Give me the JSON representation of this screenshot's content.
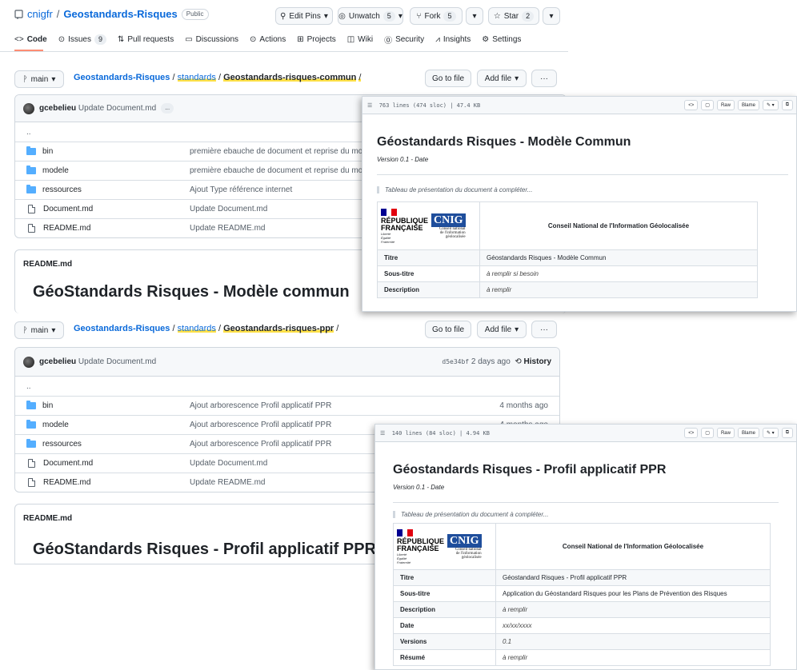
{
  "repo": {
    "owner": "cnigfr",
    "separator": "/",
    "name": "Geostandards-Risques",
    "visibility": "Public",
    "edit_pins": "Edit Pins",
    "unwatch": "Unwatch",
    "unwatch_count": "5",
    "fork": "Fork",
    "fork_count": "5",
    "star": "Star",
    "star_count": "2"
  },
  "tabs": [
    {
      "label": "Code"
    },
    {
      "label": "Issues",
      "count": "9"
    },
    {
      "label": "Pull requests"
    },
    {
      "label": "Discussions"
    },
    {
      "label": "Actions"
    },
    {
      "label": "Projects"
    },
    {
      "label": "Wiki"
    },
    {
      "label": "Security"
    },
    {
      "label": "Insights"
    },
    {
      "label": "Settings"
    }
  ],
  "common": {
    "branch": "main",
    "crumb_root": "Geostandards-Risques",
    "crumb_mid": "standards",
    "crumb_leaf": "Geostandards-risques-commun",
    "go_to_file": "Go to file",
    "add_file": "Add file",
    "more": "···",
    "commit_author": "gcebelieu",
    "commit_message": "Update Document.md",
    "commit_more": "...",
    "parent": "..",
    "files": [
      {
        "name": "bin",
        "message": "première ebauche de document et reprise du mo"
      },
      {
        "name": "modele",
        "message": "première ebauche de document et reprise du mo"
      },
      {
        "name": "ressources",
        "message": "Ajout Type référence internet"
      },
      {
        "name": "Document.md",
        "message": "Update Document.md"
      },
      {
        "name": "README.md",
        "message": "Update README.md"
      }
    ],
    "readme_label": "README.md",
    "readme_title": "GéoStandards Risques - Modèle commun"
  },
  "ppr": {
    "branch": "main",
    "crumb_root": "Geostandards-Risques",
    "crumb_mid": "standards",
    "crumb_leaf": "Geostandards-risques-ppr",
    "go_to_file": "Go to file",
    "add_file": "Add file",
    "more": "···",
    "commit_author": "gcebelieu",
    "commit_message": "Update Document.md",
    "commit_hash": "d5e34bf",
    "commit_time": "2 days ago",
    "history": "History",
    "parent": "..",
    "files": [
      {
        "name": "bin",
        "message": "Ajout arborescence Profil applicatif PPR",
        "time": "4 months ago"
      },
      {
        "name": "modele",
        "message": "Ajout arborescence Profil applicatif PPR",
        "time": "4 months ago"
      },
      {
        "name": "ressources",
        "message": "Ajout arborescence Profil applicatif PPR",
        "time": ""
      },
      {
        "name": "Document.md",
        "message": "Update Document.md",
        "time": ""
      },
      {
        "name": "README.md",
        "message": "Update README.md",
        "time": ""
      }
    ],
    "readme_label": "README.md",
    "readme_title": "GéoStandards Risques - Profil applicatif PPR"
  },
  "doc1": {
    "lines": "763 lines (474 sloc)",
    "size": "47.4 KB",
    "raw": "Raw",
    "blame": "Blame",
    "title": "Géostandards Risques - Modèle Commun",
    "version": "Version 0.1 - Date",
    "note": "Tableau de présentation du document à compléter...",
    "org": "Conseil National de l'Information Géolocalisée",
    "rows": [
      {
        "k": "Titre",
        "v": "Géostandards Risques - Modèle Commun",
        "italic": false
      },
      {
        "k": "Sous-titre",
        "v": "à remplir si besoin",
        "italic": true
      },
      {
        "k": "Description",
        "v": "à remplir",
        "italic": true
      }
    ]
  },
  "doc2": {
    "lines": "140 lines (84 sloc)",
    "size": "4.94 KB",
    "raw": "Raw",
    "blame": "Blame",
    "title": "Géostandards Risques - Profil applicatif PPR",
    "version": "Version 0.1 - Date",
    "note": "Tableau de présentation du document à compléter...",
    "org": "Conseil National de l'Information Géolocalisée",
    "rows": [
      {
        "k": "Titre",
        "v": "Géostandard Risques - Profil applicatif PPR",
        "italic": false
      },
      {
        "k": "Sous-titre",
        "v": "Application du Géostandard Risques pour les Plans de Prévention des Risques",
        "italic": false
      },
      {
        "k": "Description",
        "v": "à remplir",
        "italic": true
      },
      {
        "k": "Date",
        "v": "xx/xx/xxxx",
        "italic": true
      },
      {
        "k": "Versions",
        "v": "0.1",
        "italic": true
      },
      {
        "k": "Résumé",
        "v": "à remplir",
        "italic": true
      }
    ]
  },
  "logo": {
    "republique": "RÉPUBLIQUE",
    "francaise": "FRANÇAISE",
    "motto1": "Liberté",
    "motto2": "Égalité",
    "motto3": "Fraternité",
    "cnig": "CNIG",
    "cnig_sub1": "Conseil national",
    "cnig_sub2": "de l'information",
    "cnig_sub3": "géolocalisée"
  },
  "colors": {
    "accent": "#0969da",
    "highlight": "#fde047",
    "folder": "#54aeff"
  }
}
